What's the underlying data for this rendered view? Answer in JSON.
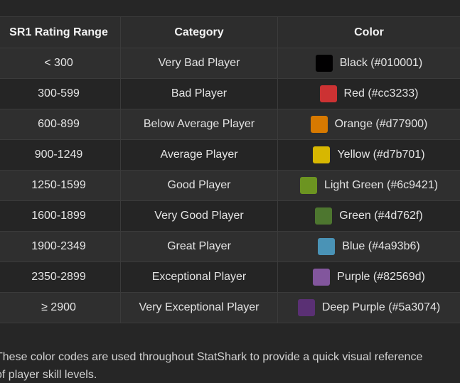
{
  "table": {
    "headers": [
      "SR1 Rating Range",
      "Category",
      "Color"
    ],
    "rows": [
      {
        "range": "< 300",
        "category": "Very Bad Player",
        "color_label": "Black (#010001)",
        "swatch": "#010001"
      },
      {
        "range": "300-599",
        "category": "Bad Player",
        "color_label": "Red (#cc3233)",
        "swatch": "#cc3233"
      },
      {
        "range": "600-899",
        "category": "Below Average Player",
        "color_label": "Orange (#d77900)",
        "swatch": "#d77900"
      },
      {
        "range": "900-1249",
        "category": "Average Player",
        "color_label": "Yellow (#d7b701)",
        "swatch": "#d7b701"
      },
      {
        "range": "1250-1599",
        "category": "Good Player",
        "color_label": "Light Green (#6c9421)",
        "swatch": "#6c9421"
      },
      {
        "range": "1600-1899",
        "category": "Very Good Player",
        "color_label": "Green (#4d762f)",
        "swatch": "#4d762f"
      },
      {
        "range": "1900-2349",
        "category": "Great Player",
        "color_label": "Blue (#4a93b6)",
        "swatch": "#4a93b6"
      },
      {
        "range": "2350-2899",
        "category": "Exceptional Player",
        "color_label": "Purple (#82569d)",
        "swatch": "#82569d"
      },
      {
        "range": "≥ 2900",
        "category": "Very Exceptional Player",
        "color_label": "Deep Purple (#5a3074)",
        "swatch": "#5a3074"
      }
    ]
  },
  "note": {
    "line1": "These color codes are used throughout StatShark to provide a quick visual reference",
    "line2": "of player skill levels."
  }
}
